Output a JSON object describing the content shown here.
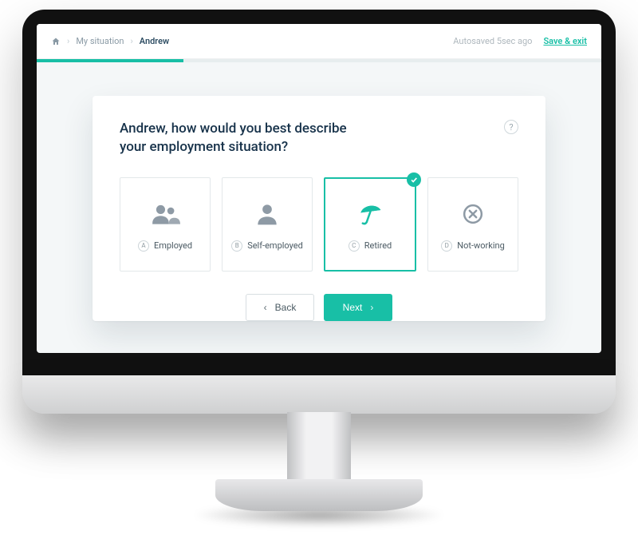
{
  "colors": {
    "accent": "#18bfa6",
    "ink": "#17324a",
    "muted": "#8a9aa5"
  },
  "header": {
    "breadcrumb": {
      "item1": "My situation",
      "item2": "Andrew"
    },
    "autosave": "Autosaved 5sec ago",
    "save_exit": "Save & exit"
  },
  "progress": {
    "percent": 26
  },
  "question": "Andrew, how would you best describe your employment situation?",
  "help_tooltip": "?",
  "options": [
    {
      "key": "A",
      "label": "Employed",
      "icon": "people-icon",
      "selected": false
    },
    {
      "key": "B",
      "label": "Self-employed",
      "icon": "person-icon",
      "selected": false
    },
    {
      "key": "C",
      "label": "Retired",
      "icon": "umbrella-icon",
      "selected": true
    },
    {
      "key": "D",
      "label": "Not-working",
      "icon": "circle-x-icon",
      "selected": false
    }
  ],
  "buttons": {
    "back": "Back",
    "next": "Next"
  }
}
